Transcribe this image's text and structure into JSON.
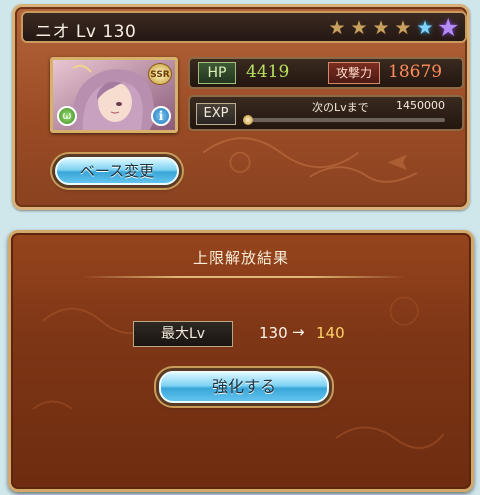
{
  "character": {
    "name_level": "ニオ Lv 130",
    "rarity_badge": "SSR",
    "stars": [
      "bronze",
      "bronze",
      "bronze",
      "bronze",
      "blue",
      "purple"
    ]
  },
  "stats": {
    "hp_label": "HP",
    "hp_value": "4419",
    "atk_label": "攻撃力",
    "atk_value": "18679"
  },
  "exp": {
    "label": "EXP",
    "next_label": "次のLvまで",
    "next_value": "1450000",
    "progress": 0.0
  },
  "buttons": {
    "base_change": "ベース変更",
    "strengthen": "強化する"
  },
  "result": {
    "title": "上限解放結果",
    "max_lv_label": "最大Lv",
    "from": "130",
    "arrow": "→",
    "to": "140"
  },
  "colors": {
    "panel_brown": "#9b4c25",
    "hp_green": "#b6e060",
    "atk_orange": "#ff8c5a",
    "lv_gold": "#ffd36a",
    "button_blue": "#7fd2f3"
  }
}
